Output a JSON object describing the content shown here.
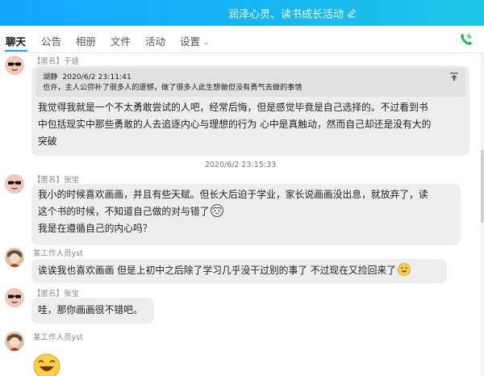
{
  "window": {
    "title": "润泽心灵、读书成长活动",
    "edit_icon": "pencil-icon"
  },
  "tabs": [
    {
      "label": "聊天",
      "active": true
    },
    {
      "label": "公告"
    },
    {
      "label": "相册"
    },
    {
      "label": "文件"
    },
    {
      "label": "活动"
    },
    {
      "label": "设置",
      "has_dropdown": true
    }
  ],
  "call_icon": "phone-icon",
  "colors": {
    "title_bar": "#16b6f2",
    "active_underline": "#1aa3ee",
    "bubble": "#eeeeee",
    "phone": "#1db954"
  },
  "messages": [
    {
      "sender": "【匿名】于途",
      "avatar": "sunglasses-avatar",
      "quote": {
        "author": "湖静",
        "time": "2020/6/2 23:11:41",
        "text": "也许，主人公弥补了很多人的遗憾，做了很多人此生想做但没有勇气去做的事情"
      },
      "lines": [
        "我觉得我就是一个不太勇敢尝试的人吧，经常后悔，但是感觉毕竟是自己选择的。不过看到书",
        "中包括现实中那些勇敢的人去追逐内心与理想的行为  心中是真触动，然而自己却还是没有大的",
        "突破"
      ]
    },
    {
      "timestamp": "2020/6/2 23:15:33"
    },
    {
      "sender": "【匿名】张宝",
      "avatar": "sunglasses-avatar",
      "lines": [
        "我小的时候喜欢画画，并且有些天赋。但长大后迫于学业，家长说画画没出息，就放弃了，读",
        "这个书的时候，不知道自己做的对与错了",
        "我是在遵循自己的内心吗？"
      ],
      "inline_emoji": "thinking-emoji"
    },
    {
      "sender": "某工作人员yst",
      "avatar": "photo-avatar",
      "lines": [
        "诶诶我也喜欢画画  但是上初中之后除了学习几乎没干过别的事了  不过现在又捡回来了"
      ],
      "inline_emoji": "smile-emoji"
    },
    {
      "sender": "【匿名】张宝",
      "avatar": "sunglasses-avatar",
      "lines": [
        "哇，那你画画很不错吧。"
      ]
    },
    {
      "sender": "某工作人员yst",
      "avatar": "photo-avatar",
      "sticker": "grin-emoji"
    }
  ]
}
